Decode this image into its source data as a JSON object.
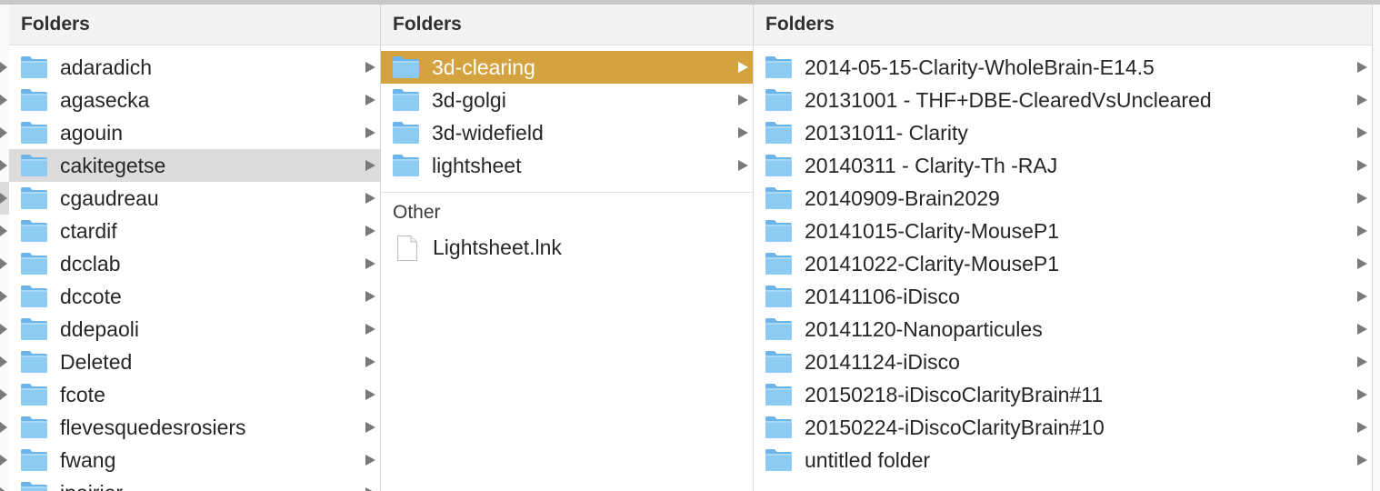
{
  "colors": {
    "selected_active": "#d4a23f",
    "selected_inactive": "#dcdcdc",
    "folder_blue": "#87c3ee"
  },
  "columns": [
    {
      "header": "Folders",
      "items": [
        "adaradich",
        "agasecka",
        "agouin",
        "cakitegetse",
        "cgaudreau",
        "ctardif",
        "dcclab",
        "dccote",
        "ddepaoli",
        "Deleted",
        "fcote",
        "flevesquedesrosiers",
        "fwang",
        "jpoirier"
      ],
      "selected": "cakitegetse"
    },
    {
      "header": "Folders",
      "items": [
        "3d-clearing",
        "3d-golgi",
        "3d-widefield",
        "lightsheet"
      ],
      "selected": "3d-clearing",
      "other_header": "Other",
      "other_items": [
        "Lightsheet.lnk"
      ]
    },
    {
      "header": "Folders",
      "items": [
        "2014-05-15-Clarity-WholeBrain-E14.5",
        "20131001 - THF+DBE-ClearedVsUncleared",
        "20131011- Clarity",
        "20140311 - Clarity-Th -RAJ",
        "20140909-Brain2029",
        "20141015-Clarity-MouseP1",
        "20141022-Clarity-MouseP1",
        "20141106-iDisco",
        "20141120-Nanoparticules",
        "20141124-iDisco",
        "20150218-iDiscoClarityBrain#11",
        "20150224-iDiscoClarityBrain#10",
        "untitled folder"
      ]
    }
  ]
}
